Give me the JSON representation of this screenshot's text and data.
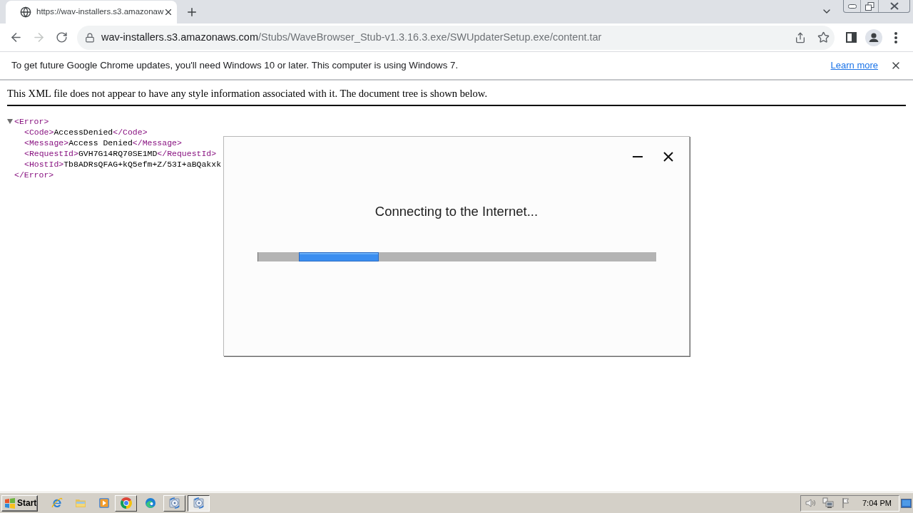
{
  "browser": {
    "tabs": [
      {
        "title": "https://wav-installers.s3.amazonaw",
        "selected": true
      }
    ],
    "navigation": {
      "back": {
        "disabled": false
      },
      "forward": {
        "disabled": true
      }
    },
    "address_bar": {
      "host": "wav-installers.s3.amazonaws.com",
      "path": "/Stubs/WaveBrowser_Stub-v1.3.16.3.exe/SWUpdaterSetup.exe/content.tar"
    },
    "infobar": {
      "message": "To get future Google Chrome updates, you'll need Windows 10 or later. This computer is using Windows 7.",
      "link": "Learn more"
    }
  },
  "page": {
    "notice": "This XML file does not appear to have any style information associated with it. The document tree is shown below.",
    "xml_tree": {
      "open": "<Error>",
      "close": "</Error>",
      "expanded": true,
      "children": [
        {
          "open": "<Code>",
          "text": "AccessDenied",
          "close": "</Code>"
        },
        {
          "open": "<Message>",
          "text": "Access Denied",
          "close": "</Message>"
        },
        {
          "open": "<RequestId>",
          "text": "GVH7G14RQ70SE1MD",
          "close": "</RequestId>"
        },
        {
          "open": "<HostId>",
          "text": "Tb8ADRsQFAG+kQ5efm+Z/53I+aBQakxk"
        }
      ]
    }
  },
  "dialog": {
    "message": "Connecting to the Internet...",
    "progress": {
      "level": 0.2
    }
  },
  "taskbar": {
    "start": "Start",
    "quick_launch": [
      {
        "kind": "ie"
      },
      {
        "kind": "folder"
      },
      {
        "kind": "media"
      }
    ],
    "windows": [
      {
        "kind": "chrome",
        "selected": false
      },
      {
        "kind": "edge",
        "selected": false
      },
      {
        "kind": "setup",
        "selected": false
      },
      {
        "kind": "setup",
        "selected": true
      }
    ],
    "clock": "7:04 PM"
  }
}
